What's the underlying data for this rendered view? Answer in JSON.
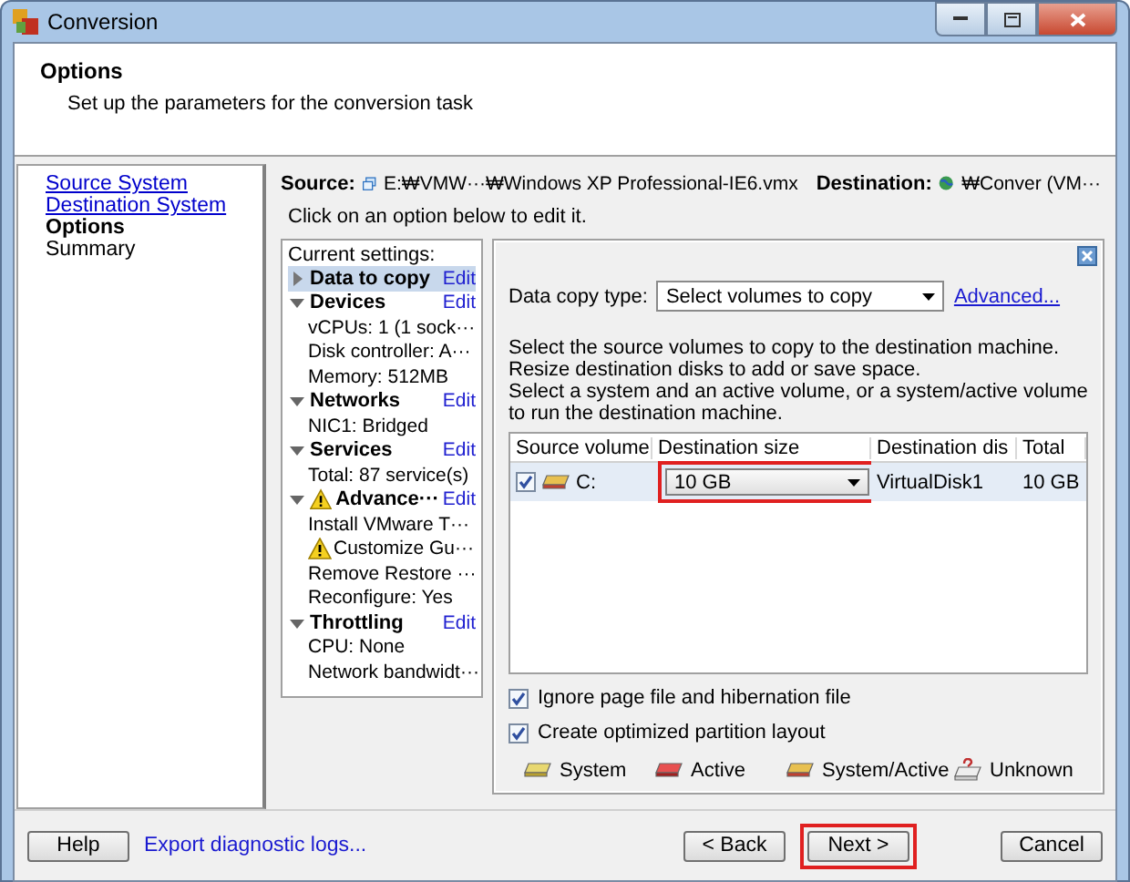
{
  "window": {
    "title": "Conversion"
  },
  "header": {
    "title": "Options",
    "subtitle": "Set up the parameters for the conversion task"
  },
  "nav": [
    {
      "label": "Source System",
      "kind": "link"
    },
    {
      "label": "Destination System",
      "kind": "link"
    },
    {
      "label": "Options",
      "kind": "current"
    },
    {
      "label": "Summary",
      "kind": "plain"
    }
  ],
  "source": {
    "label": "Source:",
    "path": "E:₩VMW···₩Windows XP Professional-IE6.vmx"
  },
  "destination": {
    "label": "Destination:",
    "path": "₩Conver (VM···"
  },
  "instruction": "Click on an option below to edit it.",
  "settings": {
    "heading": "Current settings:",
    "sections": [
      {
        "title": "Data to copy",
        "selected": true,
        "expanded": false,
        "warning": false,
        "edit": "Edit"
      },
      {
        "title": "Devices",
        "selected": false,
        "expanded": true,
        "warning": false,
        "edit": "Edit",
        "children": [
          {
            "text": "vCPUs: 1 (1 sock···",
            "warning": false
          },
          {
            "text": "Disk controller: A···",
            "warning": false
          },
          {
            "text": "Memory: 512MB",
            "warning": false
          }
        ]
      },
      {
        "title": "Networks",
        "selected": false,
        "expanded": true,
        "warning": false,
        "edit": "Edit",
        "children": [
          {
            "text": "NIC1: Bridged",
            "warning": false
          }
        ]
      },
      {
        "title": "Services",
        "selected": false,
        "expanded": true,
        "warning": false,
        "edit": "Edit",
        "children": [
          {
            "text": "Total: 87 service(s)",
            "warning": false
          }
        ]
      },
      {
        "title": "Advance···",
        "selected": false,
        "expanded": true,
        "warning": true,
        "edit": "Edit",
        "children": [
          {
            "text": "Install VMware T···",
            "warning": false
          },
          {
            "text": "Customize Gu···",
            "warning": true
          },
          {
            "text": "Remove Restore ···",
            "warning": false
          },
          {
            "text": "Reconfigure: Yes",
            "warning": false
          }
        ]
      },
      {
        "title": "Throttling",
        "selected": false,
        "expanded": true,
        "warning": false,
        "edit": "Edit",
        "children": [
          {
            "text": "CPU: None",
            "warning": false
          },
          {
            "text": "Network bandwidt···",
            "warning": false
          }
        ]
      }
    ]
  },
  "panel": {
    "copy_type_label": "Data copy type:",
    "copy_type_value": "Select volumes to copy",
    "advanced_link": "Advanced...",
    "description": [
      "Select the source volumes to copy to the destination machine.",
      "Resize destination disks to add or save space.",
      "Select a system and an active volume, or a system/active volume",
      "to run the destination machine."
    ],
    "table": {
      "columns": [
        "Source volume",
        "Destination size",
        "Destination dis",
        "Total"
      ],
      "rows": [
        {
          "checked": true,
          "kind": "system_active",
          "volume": "C:",
          "size": "10 GB",
          "size_highlighted": true,
          "disk": "VirtualDisk1",
          "total": "10 GB",
          "selected": true
        }
      ]
    },
    "options": [
      {
        "label": "Ignore page file and hibernation file",
        "checked": true
      },
      {
        "label": "Create optimized partition layout",
        "checked": true
      }
    ],
    "legend": [
      {
        "kind": "system",
        "label": "System"
      },
      {
        "kind": "active",
        "label": "Active"
      },
      {
        "kind": "system_active",
        "label": "System/Active"
      },
      {
        "kind": "unknown",
        "label": "Unknown"
      }
    ]
  },
  "footer": {
    "help": "Help",
    "export_link": "Export diagnostic logs...",
    "back": "< Back",
    "next": "Next >",
    "next_highlighted": true,
    "cancel": "Cancel"
  }
}
